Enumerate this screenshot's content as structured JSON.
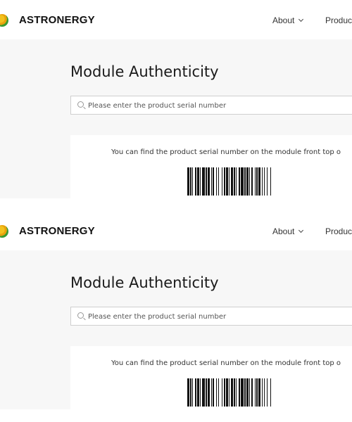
{
  "header": {
    "brand": "ASTRONERGY",
    "nav": [
      {
        "label": "About",
        "has_dropdown": true
      },
      {
        "label": "Produc"
      }
    ]
  },
  "main": {
    "title": "Module Authenticity",
    "search": {
      "value": "",
      "placeholder": "Please enter the product serial number"
    },
    "info_text": "You can find the product serial number on the module front top o",
    "barcode_icon": "barcode"
  },
  "colors": {
    "page_bg": "#f7f7f7",
    "header_bg": "#ffffff",
    "text": "#1a1a1a",
    "logo_green": "#3b9b2f",
    "logo_orange": "#e8a20c"
  }
}
